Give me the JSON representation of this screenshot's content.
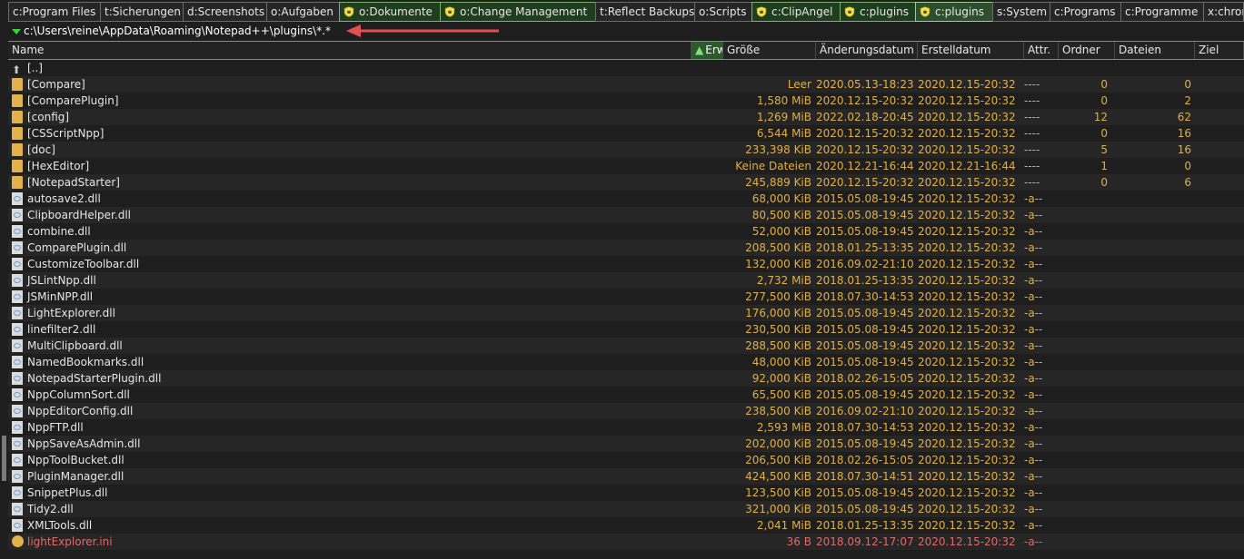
{
  "tabs": [
    {
      "label": "c:Program Files",
      "locked": false,
      "active": false
    },
    {
      "label": "t:Sicherungen",
      "locked": false,
      "active": false
    },
    {
      "label": "d:Screenshots",
      "locked": false,
      "active": false
    },
    {
      "label": "o:Aufgaben",
      "locked": false,
      "active": false
    },
    {
      "label": "o:Dokumente",
      "locked": true,
      "active": false
    },
    {
      "label": "o:Change Management",
      "locked": true,
      "active": false
    },
    {
      "label": "t:Reflect Backups",
      "locked": false,
      "active": false
    },
    {
      "label": "o:Scripts",
      "locked": false,
      "active": false
    },
    {
      "label": "c:ClipAngel",
      "locked": true,
      "active": false
    },
    {
      "label": "c:plugins",
      "locked": true,
      "active": false
    },
    {
      "label": "c:plugins",
      "locked": true,
      "active": true
    },
    {
      "label": "s:System",
      "locked": false,
      "active": false
    },
    {
      "label": "c:Programs",
      "locked": false,
      "active": false
    },
    {
      "label": "c:Programme",
      "locked": false,
      "active": false
    },
    {
      "label": "x:chron",
      "locked": false,
      "active": false
    }
  ],
  "path": "c:\\Users\\reine\\AppData\\Roaming\\Notepad++\\plugins\\*.*",
  "columns": [
    "Name",
    "Erw",
    "Größe",
    "Änderungsdatum",
    "Erstelldatum",
    "Attr.",
    "Ordner",
    "Dateien",
    "Ziel"
  ],
  "rows": [
    {
      "type": "up",
      "name": "[..]",
      "size": "",
      "mdate": "",
      "cdate": "",
      "attr": "",
      "folders": "",
      "files": ""
    },
    {
      "type": "folder",
      "name": "[Compare]",
      "size": "Leer",
      "mdate": "2020.05.13-18:23",
      "cdate": "2020.12.15-20:32",
      "attr": "----",
      "folders": "0",
      "files": "0"
    },
    {
      "type": "folder",
      "name": "[ComparePlugin]",
      "size": "1,580 MiB",
      "mdate": "2020.12.15-20:32",
      "cdate": "2020.12.15-20:32",
      "attr": "----",
      "folders": "0",
      "files": "2"
    },
    {
      "type": "folder",
      "name": "[config]",
      "size": "1,269 MiB",
      "mdate": "2022.02.18-20:45",
      "cdate": "2020.12.15-20:32",
      "attr": "----",
      "folders": "12",
      "files": "62"
    },
    {
      "type": "folder",
      "name": "[CSScriptNpp]",
      "size": "6,544 MiB",
      "mdate": "2020.12.15-20:32",
      "cdate": "2020.12.15-20:32",
      "attr": "----",
      "folders": "0",
      "files": "16"
    },
    {
      "type": "folder",
      "name": "[doc]",
      "size": "233,398 KiB",
      "mdate": "2020.12.15-20:32",
      "cdate": "2020.12.15-20:32",
      "attr": "----",
      "folders": "5",
      "files": "16"
    },
    {
      "type": "folder",
      "name": "[HexEditor]",
      "size": "Keine Dateien",
      "mdate": "2020.12.21-16:44",
      "cdate": "2020.12.21-16:44",
      "attr": "----",
      "folders": "1",
      "files": "0"
    },
    {
      "type": "folder",
      "name": "[NotepadStarter]",
      "size": "245,889 KiB",
      "mdate": "2020.12.15-20:32",
      "cdate": "2020.12.15-20:32",
      "attr": "----",
      "folders": "0",
      "files": "6"
    },
    {
      "type": "file",
      "name": "autosave2.dll",
      "size": "68,000 KiB",
      "mdate": "2015.05.08-19:45",
      "cdate": "2020.12.15-20:32",
      "attr": "-a--",
      "folders": "",
      "files": ""
    },
    {
      "type": "file",
      "name": "ClipboardHelper.dll",
      "size": "80,500 KiB",
      "mdate": "2015.05.08-19:45",
      "cdate": "2020.12.15-20:32",
      "attr": "-a--",
      "folders": "",
      "files": ""
    },
    {
      "type": "file",
      "name": "combine.dll",
      "size": "52,000 KiB",
      "mdate": "2015.05.08-19:45",
      "cdate": "2020.12.15-20:32",
      "attr": "-a--",
      "folders": "",
      "files": ""
    },
    {
      "type": "file",
      "name": "ComparePlugin.dll",
      "size": "208,500 KiB",
      "mdate": "2018.01.25-13:35",
      "cdate": "2020.12.15-20:32",
      "attr": "-a--",
      "folders": "",
      "files": ""
    },
    {
      "type": "file",
      "name": "CustomizeToolbar.dll",
      "size": "132,000 KiB",
      "mdate": "2016.09.02-21:10",
      "cdate": "2020.12.15-20:32",
      "attr": "-a--",
      "folders": "",
      "files": ""
    },
    {
      "type": "file",
      "name": "JSLintNpp.dll",
      "size": "2,732 MiB",
      "mdate": "2018.01.25-13:35",
      "cdate": "2020.12.15-20:32",
      "attr": "-a--",
      "folders": "",
      "files": ""
    },
    {
      "type": "file",
      "name": "JSMinNPP.dll",
      "size": "277,500 KiB",
      "mdate": "2018.07.30-14:53",
      "cdate": "2020.12.15-20:32",
      "attr": "-a--",
      "folders": "",
      "files": ""
    },
    {
      "type": "file",
      "name": "LightExplorer.dll",
      "size": "176,000 KiB",
      "mdate": "2015.05.08-19:45",
      "cdate": "2020.12.15-20:32",
      "attr": "-a--",
      "folders": "",
      "files": ""
    },
    {
      "type": "file",
      "name": "linefilter2.dll",
      "size": "230,500 KiB",
      "mdate": "2015.05.08-19:45",
      "cdate": "2020.12.15-20:32",
      "attr": "-a--",
      "folders": "",
      "files": ""
    },
    {
      "type": "file",
      "name": "MultiClipboard.dll",
      "size": "288,500 KiB",
      "mdate": "2015.05.08-19:45",
      "cdate": "2020.12.15-20:32",
      "attr": "-a--",
      "folders": "",
      "files": ""
    },
    {
      "type": "file",
      "name": "NamedBookmarks.dll",
      "size": "48,000 KiB",
      "mdate": "2015.05.08-19:45",
      "cdate": "2020.12.15-20:32",
      "attr": "-a--",
      "folders": "",
      "files": ""
    },
    {
      "type": "file",
      "name": "NotepadStarterPlugin.dll",
      "size": "92,000 KiB",
      "mdate": "2018.02.26-15:05",
      "cdate": "2020.12.15-20:32",
      "attr": "-a--",
      "folders": "",
      "files": ""
    },
    {
      "type": "file",
      "name": "NppColumnSort.dll",
      "size": "65,500 KiB",
      "mdate": "2015.05.08-19:45",
      "cdate": "2020.12.15-20:32",
      "attr": "-a--",
      "folders": "",
      "files": ""
    },
    {
      "type": "file",
      "name": "NppEditorConfig.dll",
      "size": "238,500 KiB",
      "mdate": "2016.09.02-21:10",
      "cdate": "2020.12.15-20:32",
      "attr": "-a--",
      "folders": "",
      "files": ""
    },
    {
      "type": "file",
      "name": "NppFTP.dll",
      "size": "2,593 MiB",
      "mdate": "2018.07.30-14:53",
      "cdate": "2020.12.15-20:32",
      "attr": "-a--",
      "folders": "",
      "files": ""
    },
    {
      "type": "file",
      "name": "NppSaveAsAdmin.dll",
      "size": "202,000 KiB",
      "mdate": "2015.05.08-19:45",
      "cdate": "2020.12.15-20:32",
      "attr": "-a--",
      "folders": "",
      "files": ""
    },
    {
      "type": "file",
      "name": "NppToolBucket.dll",
      "size": "206,500 KiB",
      "mdate": "2018.02.26-15:05",
      "cdate": "2020.12.15-20:32",
      "attr": "-a--",
      "folders": "",
      "files": ""
    },
    {
      "type": "file",
      "name": "PluginManager.dll",
      "size": "424,500 KiB",
      "mdate": "2018.07.30-14:51",
      "cdate": "2020.12.15-20:32",
      "attr": "-a--",
      "folders": "",
      "files": ""
    },
    {
      "type": "file",
      "name": "SnippetPlus.dll",
      "size": "123,500 KiB",
      "mdate": "2015.05.08-19:45",
      "cdate": "2020.12.15-20:32",
      "attr": "-a--",
      "folders": "",
      "files": ""
    },
    {
      "type": "file",
      "name": "Tidy2.dll",
      "size": "321,000 KiB",
      "mdate": "2015.05.08-19:45",
      "cdate": "2020.12.15-20:32",
      "attr": "-a--",
      "folders": "",
      "files": ""
    },
    {
      "type": "file",
      "name": "XMLTools.dll",
      "size": "2,041 MiB",
      "mdate": "2018.01.25-13:35",
      "cdate": "2020.12.15-20:32",
      "attr": "-a--",
      "folders": "",
      "files": ""
    },
    {
      "type": "ini",
      "name": "lightExplorer.ini",
      "size": "36 B",
      "mdate": "2018.09.12-17:07",
      "cdate": "2020.12.15-20:32",
      "attr": "-a--",
      "folders": "",
      "files": ""
    }
  ],
  "colors": {
    "size_text": "#e0b048",
    "attr_text": "#e0b048",
    "red_file": "#e06a6a",
    "accent_green": "#39d339",
    "header_border": "#b8860b"
  }
}
